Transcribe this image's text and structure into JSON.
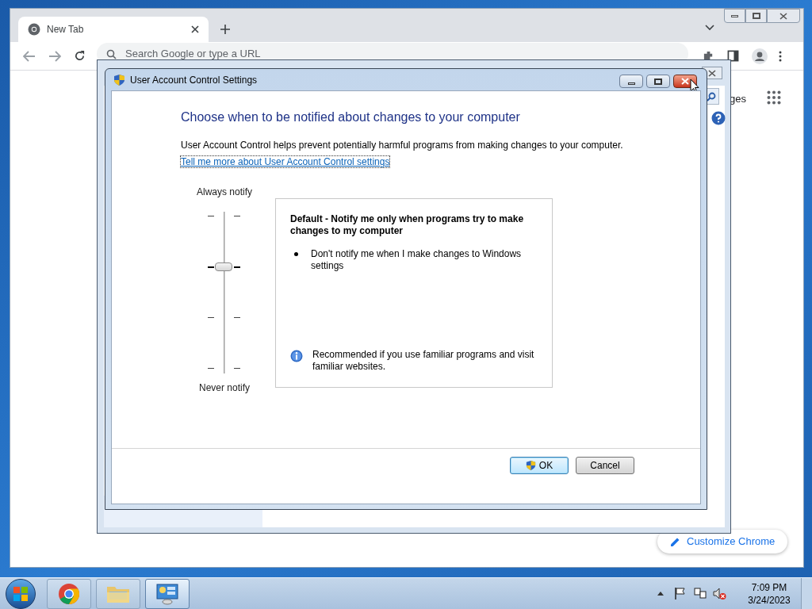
{
  "browser": {
    "tab": {
      "title": "New Tab",
      "selected": true
    },
    "omnibox": {
      "placeholder": "Search Google or type a URL"
    },
    "partial_link": "ges",
    "customize_button": "Customize Chrome"
  },
  "dialog": {
    "title": "User Account Control Settings",
    "heading": "Choose when to be notified about changes to your computer",
    "description": "User Account Control helps prevent potentially harmful programs from making changes to your computer.",
    "link": "Tell me more about User Account Control settings",
    "slider": {
      "top_label": "Always notify",
      "bottom_label": "Never notify",
      "level": 0.667
    },
    "info": {
      "title": "Default - Notify me only when programs try to make changes to my computer",
      "bullets": [
        "Don't notify me when I make changes to Windows settings"
      ],
      "note": "Recommended if you use familiar programs and visit familiar websites."
    },
    "buttons": [
      {
        "label": "OK",
        "kind": "default"
      },
      {
        "label": "Cancel",
        "kind": "normal"
      }
    ]
  },
  "taskbar": {
    "items": [
      {
        "kind": "chrome",
        "selected": false
      },
      {
        "kind": "explorer",
        "selected": false
      },
      {
        "kind": "control-panel",
        "selected": true
      }
    ],
    "time": "7:09 PM",
    "date": "3/24/2023"
  }
}
